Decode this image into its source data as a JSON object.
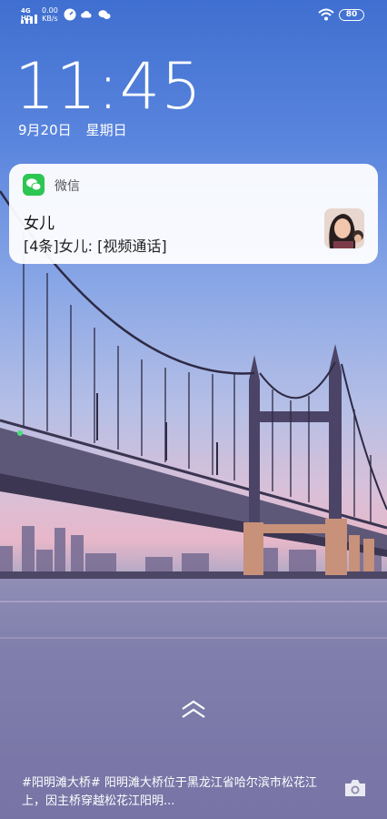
{
  "status_bar": {
    "network": "4G HD",
    "speed_value": "0.00",
    "speed_unit": "KB/s",
    "battery": "80",
    "icons": [
      "signal-icon",
      "speed-icon",
      "weather-icon",
      "wechat-status-icon",
      "wifi-icon",
      "battery-icon"
    ]
  },
  "lock": {
    "time": "11:45",
    "date": "9月20日",
    "weekday": "星期日"
  },
  "notification": {
    "app": "微信",
    "sender": "女儿",
    "message": "[4条]女儿: [视频通话]"
  },
  "wallpaper": {
    "caption": "#阳明滩大桥#  阳明滩大桥位于黑龙江省哈尔滨市松花江上，因主桥穿越松花江阳明..."
  },
  "colors": {
    "accent_wechat": "#2dc653",
    "card_bg": "#ffffff"
  }
}
